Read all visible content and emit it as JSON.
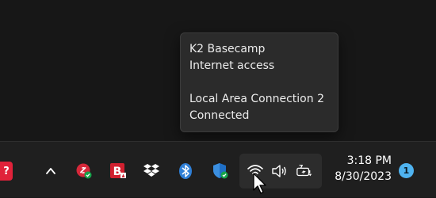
{
  "tooltip": {
    "network_name": "K2 Basecamp",
    "network_status": "Internet access",
    "connection_name": "Local Area Connection 2",
    "connection_status": "Connected"
  },
  "taskbar": {
    "pinned_app_glyph": "?",
    "tray_icons": [
      "chevron-up-icon",
      "lastpass-icon",
      "bitdefender-icon",
      "dropbox-icon",
      "bluetooth-icon",
      "windows-security-icon",
      "wifi-icon",
      "volume-icon",
      "battery-charging-icon"
    ],
    "clock_time": "3:18 PM",
    "clock_date": "8/30/2023",
    "notification_count": "1"
  },
  "colors": {
    "desktop_bg": "#171717",
    "taskbar_bg": "#1f1f1f",
    "tooltip_bg": "#2b2b2b",
    "accent_blue": "#4fb3f0",
    "brand_red": "#e0223a",
    "security_green": "#16a34a"
  }
}
